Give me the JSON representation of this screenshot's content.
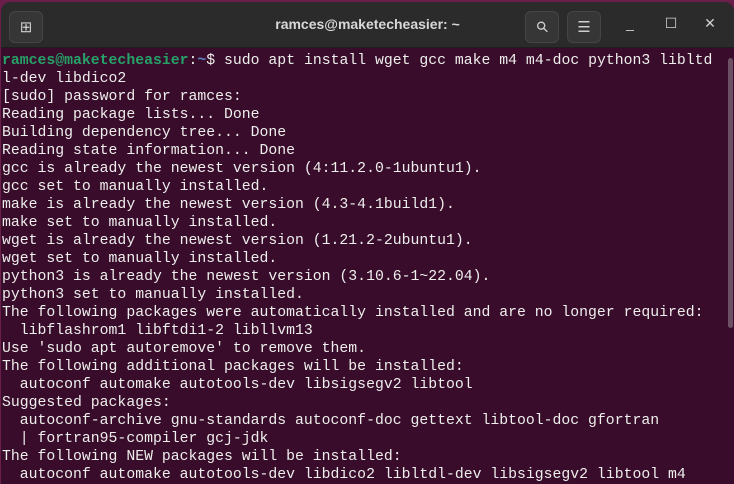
{
  "window": {
    "title": "ramces@maketecheasier: ~"
  },
  "prompt": {
    "user_host": "ramces@maketecheasier",
    "sep": ":",
    "path": "~",
    "symbol": "$ ",
    "command": "sudo apt install wget gcc make m4 m4-doc python3 libltd"
  },
  "output": [
    "l-dev libdico2",
    "[sudo] password for ramces:",
    "Reading package lists... Done",
    "Building dependency tree... Done",
    "Reading state information... Done",
    "gcc is already the newest version (4:11.2.0-1ubuntu1).",
    "gcc set to manually installed.",
    "make is already the newest version (4.3-4.1build1).",
    "make set to manually installed.",
    "wget is already the newest version (1.21.2-2ubuntu1).",
    "wget set to manually installed.",
    "python3 is already the newest version (3.10.6-1~22.04).",
    "python3 set to manually installed.",
    "The following packages were automatically installed and are no longer required:",
    "  libflashrom1 libftdi1-2 libllvm13",
    "Use 'sudo apt autoremove' to remove them.",
    "The following additional packages will be installed:",
    "  autoconf automake autotools-dev libsigsegv2 libtool",
    "Suggested packages:",
    "  autoconf-archive gnu-standards autoconf-doc gettext libtool-doc gfortran",
    "  | fortran95-compiler gcj-jdk",
    "The following NEW packages will be installed:",
    "  autoconf automake autotools-dev libdico2 libltdl-dev libsigsegv2 libtool m4"
  ],
  "icons": {
    "new_tab": "⊞",
    "search": "⚲",
    "menu": "☰",
    "minimize": "_",
    "maximize": "☐",
    "close": "✕"
  }
}
